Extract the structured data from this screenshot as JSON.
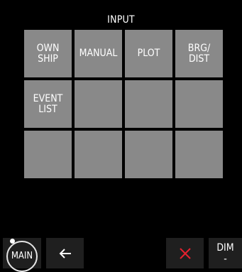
{
  "header": {
    "title": "INPUT"
  },
  "grid": {
    "cells": [
      {
        "label": "OWN\nSHIP"
      },
      {
        "label": "MANUAL"
      },
      {
        "label": "PLOT"
      },
      {
        "label": "BRG/\nDIST"
      },
      {
        "label": "EVENT\nLIST"
      },
      {
        "label": ""
      },
      {
        "label": ""
      },
      {
        "label": ""
      },
      {
        "label": ""
      },
      {
        "label": ""
      },
      {
        "label": ""
      },
      {
        "label": ""
      }
    ]
  },
  "bottom_bar": {
    "main_label": "MAIN",
    "dim_label": "DIM",
    "dim_sub": "-"
  },
  "colors": {
    "background": "#000000",
    "cell": "#898989",
    "button_bg": "#1f1f1f",
    "cancel_icon": "#e8212f"
  },
  "icons": {
    "back": "left-arrow-icon",
    "cancel": "close-icon"
  }
}
